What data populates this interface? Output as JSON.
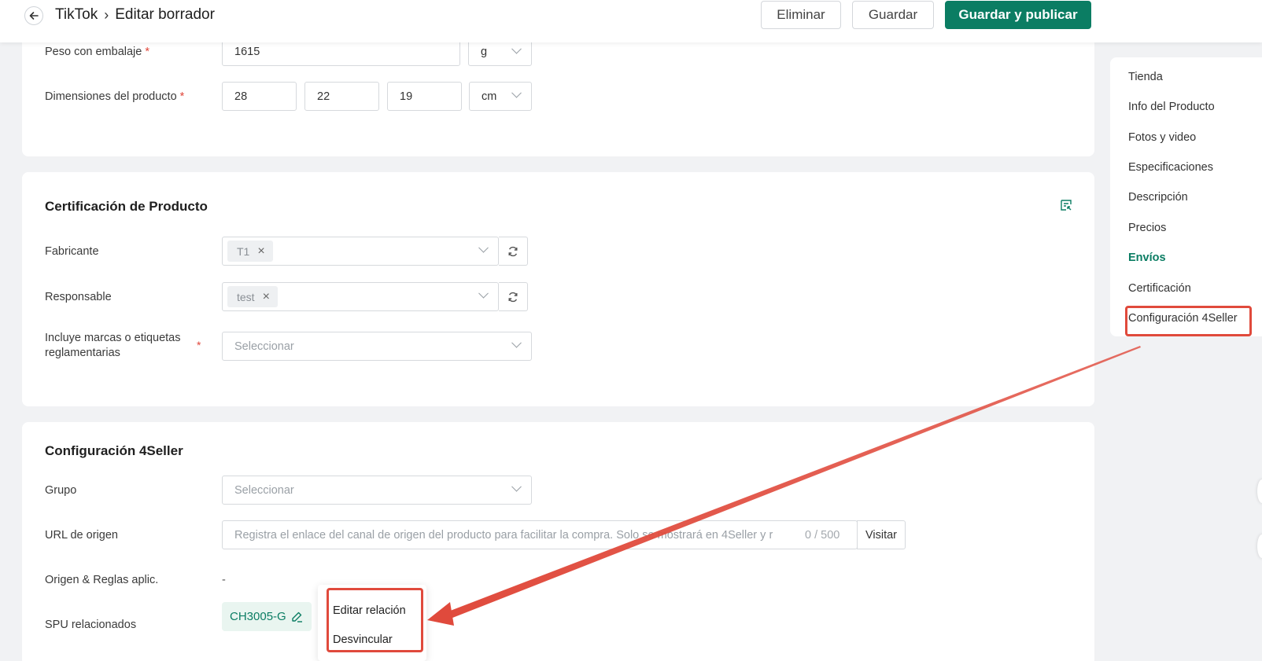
{
  "header": {
    "breadcrumb": [
      "TikTok",
      "Editar borrador"
    ],
    "delete_label": "Eliminar",
    "save_label": "Guardar",
    "publish_label": "Guardar y publicar"
  },
  "shipping": {
    "weight_label": "Peso con embalaje",
    "weight_value": "1615",
    "weight_unit": "g",
    "dimensions_label": "Dimensiones del producto",
    "length": "28",
    "width": "22",
    "height": "19",
    "dim_unit": "cm"
  },
  "certification": {
    "title": "Certificación de Producto",
    "manufacturer_label": "Fabricante",
    "manufacturer_tag": "T1",
    "responsible_label": "Responsable",
    "responsible_tag": "test",
    "marks_label": "Incluye marcas o etiquetas reglamentarias",
    "marks_placeholder": "Seleccionar"
  },
  "config": {
    "title": "Configuración 4Seller",
    "group_label": "Grupo",
    "group_placeholder": "Seleccionar",
    "url_label": "URL de origen",
    "url_placeholder": "Registra el enlace del canal de origen del producto para facilitar la compra. Solo se mostrará en 4Seller y r",
    "url_counter": "0 / 500",
    "visit_label": "Visitar",
    "origin_label": "Origen & Reglas aplic.",
    "origin_value": "-",
    "spu_label": "SPU relacionados",
    "spu_value": "CH3005-G"
  },
  "spu_menu": {
    "edit_label": "Editar relación",
    "unlink_label": "Desvincular"
  },
  "right_nav": {
    "items": [
      "Tienda",
      "Info del Producto",
      "Fotos y video",
      "Especificaciones",
      "Descripción",
      "Precios",
      "Envíos",
      "Certificación",
      "Configuración 4Seller"
    ],
    "active": "Envíos"
  },
  "colors": {
    "accent": "#0b7d63",
    "annotation": "#e04a3c"
  }
}
